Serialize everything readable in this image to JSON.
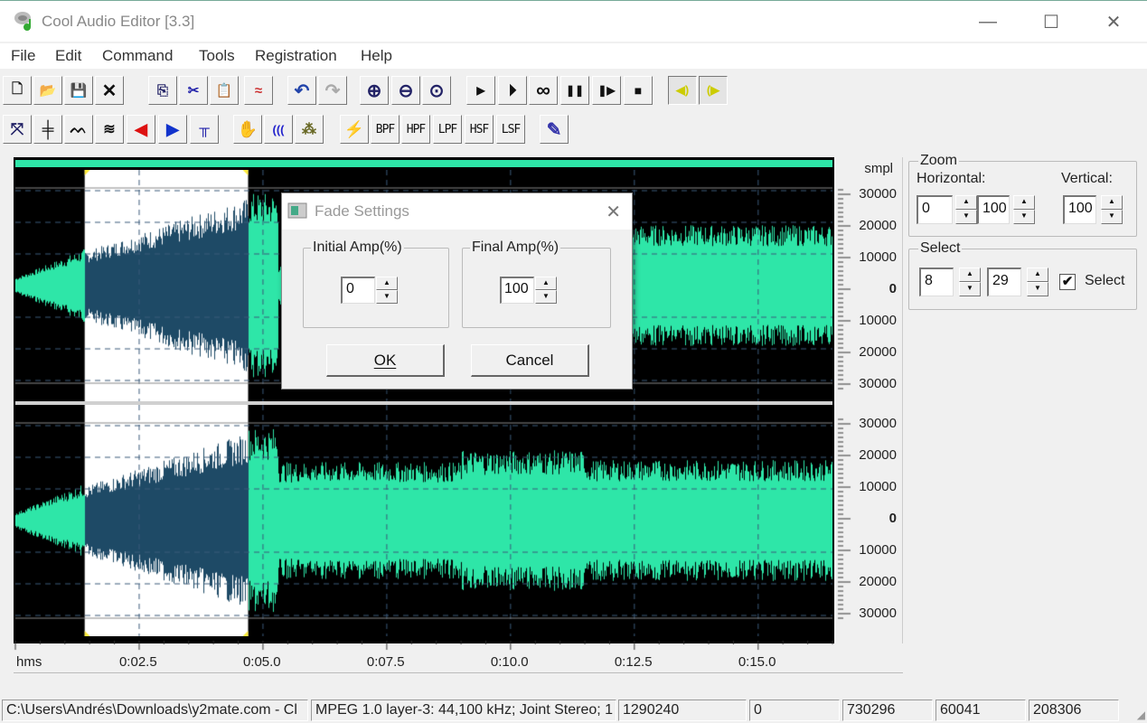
{
  "window": {
    "title": "Cool Audio Editor [3.3]",
    "controls": {
      "minimize": "—",
      "maximize": "☐",
      "close": "✕"
    }
  },
  "menu": [
    "File",
    "Edit",
    "Command",
    "Tools",
    "Registration",
    "Help"
  ],
  "toolbar1": [
    {
      "name": "new",
      "icon": "new-file-icon",
      "glyph": "🗋"
    },
    {
      "name": "open",
      "icon": "open-folder-icon",
      "glyph": "📂"
    },
    {
      "name": "save",
      "icon": "save-icon",
      "glyph": "💾"
    },
    {
      "name": "close",
      "icon": "close-icon",
      "glyph": "✕"
    },
    {
      "name": "copy",
      "icon": "copy-icon",
      "glyph": "⎘"
    },
    {
      "name": "cut",
      "icon": "scissors-icon",
      "glyph": "✂"
    },
    {
      "name": "paste",
      "icon": "paste-icon",
      "glyph": "📋"
    },
    {
      "name": "mix-paste",
      "icon": "mix-paste-icon",
      "glyph": "≈"
    },
    {
      "name": "undo",
      "icon": "undo-icon",
      "glyph": "↶"
    },
    {
      "name": "redo",
      "icon": "redo-icon",
      "glyph": "↷"
    },
    {
      "name": "zoom-in",
      "icon": "zoom-in-icon",
      "glyph": "⊕"
    },
    {
      "name": "zoom-out",
      "icon": "zoom-out-icon",
      "glyph": "⊖"
    },
    {
      "name": "zoom-1to1",
      "icon": "zoom-fit-icon",
      "glyph": "⊙"
    },
    {
      "name": "play",
      "icon": "play-icon",
      "glyph": "▶"
    },
    {
      "name": "play-selection",
      "icon": "play-circle-icon",
      "glyph": "⏵"
    },
    {
      "name": "loop",
      "icon": "loop-icon",
      "glyph": "∞"
    },
    {
      "name": "pause",
      "icon": "pause-icon",
      "glyph": "❚❚"
    },
    {
      "name": "play-from-cursor",
      "icon": "play-step-icon",
      "glyph": "❚▶"
    },
    {
      "name": "stop",
      "icon": "stop-icon",
      "glyph": "■"
    },
    {
      "name": "left-channel",
      "icon": "speaker-left-icon",
      "glyph": "◀)"
    },
    {
      "name": "right-channel",
      "icon": "speaker-right-icon",
      "glyph": "(▶"
    }
  ],
  "toolbar2": [
    {
      "name": "expand",
      "icon": "expand-icon",
      "glyph": "⤧"
    },
    {
      "name": "insert-silence",
      "icon": "insert-icon",
      "glyph": "╪"
    },
    {
      "name": "noise",
      "icon": "noise-icon",
      "glyph": "ᨓ"
    },
    {
      "name": "flatten",
      "icon": "flatten-icon",
      "glyph": "≋"
    },
    {
      "name": "fade-in",
      "icon": "fade-in-icon",
      "glyph": "◀"
    },
    {
      "name": "fade-out",
      "icon": "fade-out-icon",
      "glyph": "▶"
    },
    {
      "name": "normalize",
      "icon": "normalize-icon",
      "glyph": "╥"
    },
    {
      "name": "hand-tool",
      "icon": "hand-icon",
      "glyph": "✋"
    },
    {
      "name": "echo",
      "icon": "echo-icon",
      "glyph": "((("
    },
    {
      "name": "reverse",
      "icon": "reverse-icon",
      "glyph": "⁂"
    },
    {
      "name": "effects",
      "icon": "magic-icon",
      "glyph": "⚡"
    },
    {
      "name": "bpf",
      "label": "BPF"
    },
    {
      "name": "hpf",
      "label": "HPF"
    },
    {
      "name": "lpf",
      "label": "LPF"
    },
    {
      "name": "hsf",
      "label": "HSF"
    },
    {
      "name": "lsf",
      "label": "LSF"
    },
    {
      "name": "edit-properties",
      "icon": "pencil-edit-icon",
      "glyph": "✎"
    }
  ],
  "waveform": {
    "colors": {
      "wave": "#2ee6a8",
      "selected_wave": "#1e4a66",
      "selection_bg": "#ffffff",
      "background": "#000000",
      "marker": "#ffeb3b"
    },
    "selection": {
      "start_seconds": 1.4,
      "end_seconds": 4.7
    },
    "duration_seconds": 16.5,
    "vertical_unit": "smpl",
    "vertical_labels": [
      "30000",
      "20000",
      "10000",
      "0",
      "10000",
      "20000",
      "30000"
    ],
    "time_unit": "hms",
    "time_labels": [
      "0:02.5",
      "0:05.0",
      "0:07.5",
      "0:10.0",
      "0:12.5",
      "0:15.0"
    ]
  },
  "zoom_panel": {
    "title": "Zoom",
    "horizontal_label": "Horizontal:",
    "vertical_label": "Vertical:",
    "horizontal_from": "0",
    "horizontal_to": "100",
    "vertical_value": "100"
  },
  "select_panel": {
    "title": "Select",
    "from": "8",
    "to": "29",
    "checkbox_label": "Select",
    "checked": true,
    "check_glyph": "✔"
  },
  "dialog": {
    "title": "Fade Settings",
    "close_glyph": "✕",
    "initial_group": "Initial Amp(%)",
    "initial_value": "0",
    "final_group": "Final Amp(%)",
    "final_value": "100",
    "ok_label": "OK",
    "cancel_label": "Cancel"
  },
  "statusbar": [
    "C:\\Users\\Andrés\\Downloads\\y2mate.com - Cl",
    "MPEG 1.0 layer-3: 44,100 kHz; Joint Stereo; 1",
    "1290240",
    "0",
    "730296",
    "60041",
    "208306"
  ],
  "spin_up": "▲",
  "spin_down": "▼"
}
